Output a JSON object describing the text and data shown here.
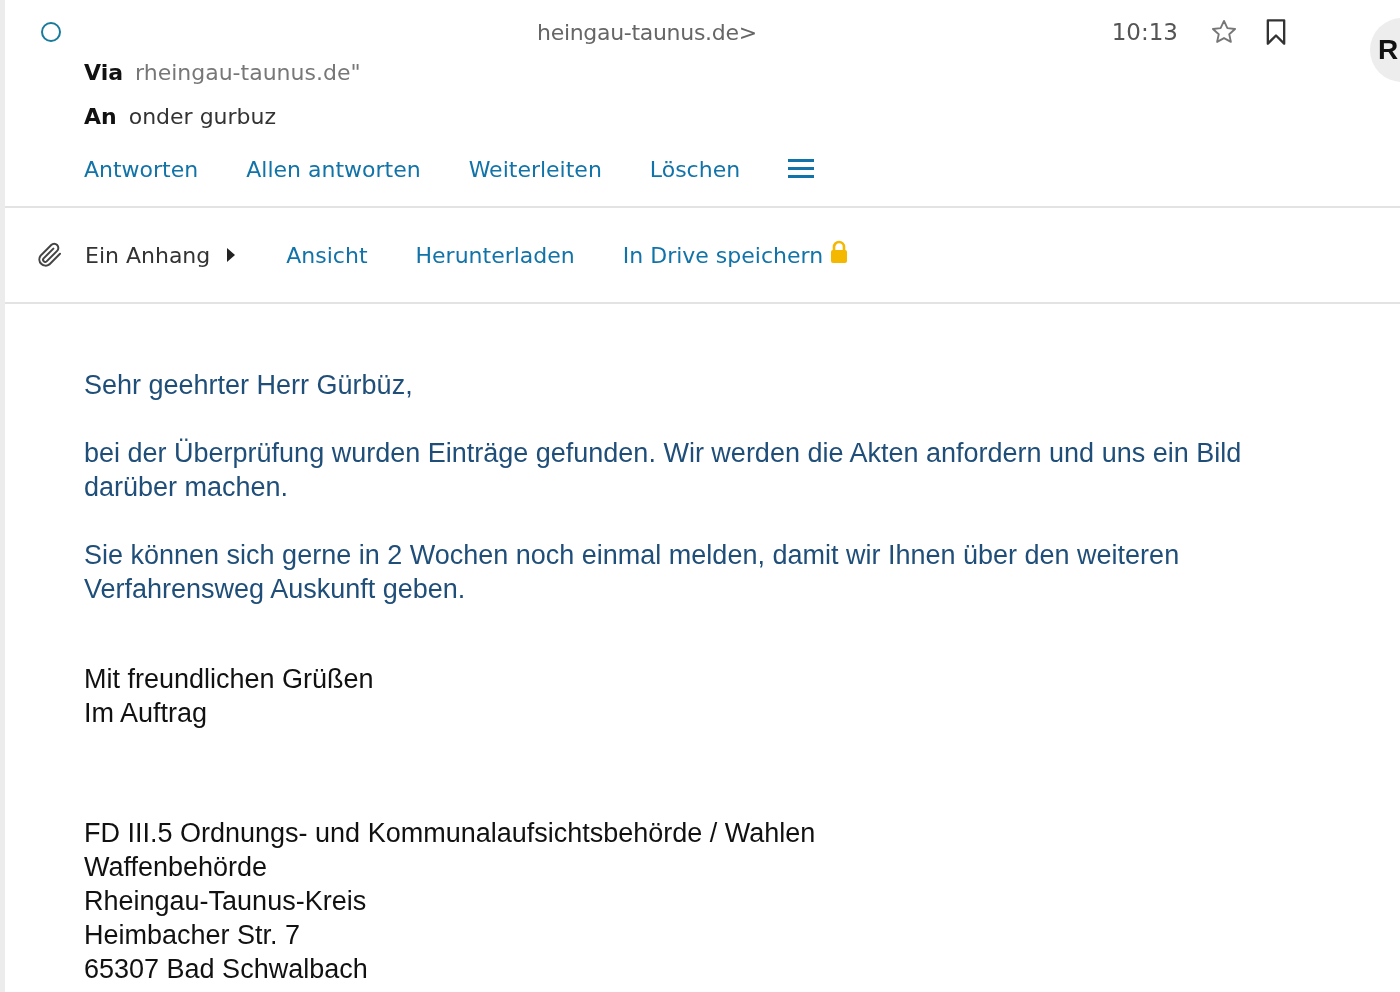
{
  "header": {
    "sender": "heingau-taunus.de>",
    "time": "10:13",
    "starred": false,
    "avatar": "R",
    "via_label": "Via",
    "via": "rheingau-taunus.de\"",
    "to_label": "An",
    "to": "onder gurbuz"
  },
  "actions": [
    "Antworten",
    "Allen antworten",
    "Weiterleiten",
    "Löschen"
  ],
  "attachment": {
    "label": "Ein Anhang",
    "actions": [
      "Ansicht",
      "Herunterladen",
      "In Drive speichern"
    ]
  },
  "body": {
    "paragraphs": [
      "Sehr geehrter Herr Gürbüz,",
      "bei der Überprüfung wurden Einträge gefunden. Wir werden die Akten anfordern und uns ein Bild darüber machen.",
      "Sie können sich gerne in 2 Wochen noch einmal melden, damit wir Ihnen über den weiteren Verfahrensweg Auskunft geben."
    ],
    "closing": [
      "Mit freundlichen Grüßen",
      "Im Auftrag"
    ],
    "signature": [
      "FD III.5 Ordnungs- und Kommunalaufsichtsbehörde / Wahlen",
      "Waffenbehörde",
      "Rheingau-Taunus-Kreis",
      "Heimbacher Str. 7",
      "65307 Bad Schwalbach"
    ]
  }
}
